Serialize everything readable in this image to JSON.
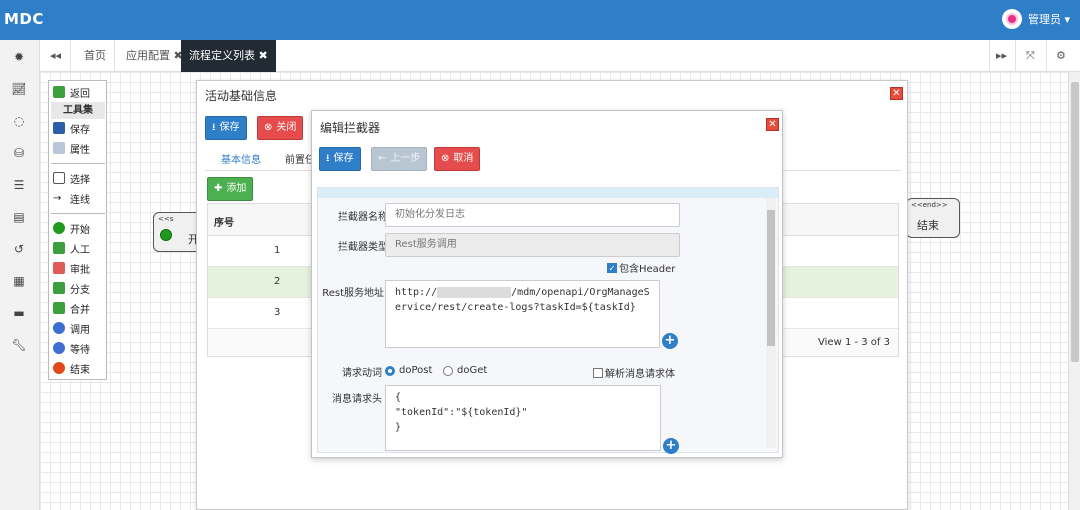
{
  "app": {
    "logo": "MDC",
    "user_name": "管理员 ▾"
  },
  "tabs": {
    "home": "首页",
    "app_config": "应用配置 ✖",
    "flow_list": "流程定义列表 ✖"
  },
  "toolbox": {
    "back": "返回",
    "title": "工具集",
    "save": "保存",
    "props": "属性",
    "select": "选择",
    "connect": "连线",
    "start": "开始",
    "manual": "人工",
    "approve": "审批",
    "branch": "分支",
    "merge": "合并",
    "invoke": "调用",
    "wait": "等待",
    "end": "结束"
  },
  "flow": {
    "start_tag": "<<s",
    "start_label": "开",
    "end_tag": "<<end>>",
    "end_label": "结束"
  },
  "activity_dialog": {
    "title": "活动基础信息",
    "save": "保存",
    "close": "关闭",
    "tab_basic": "基本信息",
    "tab_pre": "前置任",
    "add": "添加",
    "col_seq": "序号",
    "rows": [
      "1",
      "2",
      "3"
    ],
    "pager": "View 1 - 3 of 3"
  },
  "interceptor_dialog": {
    "title": "编辑拦截器",
    "save": "保存",
    "prev": "上一步",
    "cancel": "取消",
    "name_label": "拦截器名称",
    "name_placeholder": "初始化分发日志",
    "type_label": "拦截器类型",
    "type_value": "Rest服务调用",
    "include_header": "包含Header",
    "url_label": "Rest服务地址",
    "url_prefix": "http://",
    "url_rest": "/mdm/openapi/OrgManageService/rest/create-logs?taskId=${taskId}",
    "method_label": "请求动词",
    "method_post": "doPost",
    "method_get": "doGet",
    "parse_body": "解析消息请求体",
    "headers_label": "消息请求头",
    "headers_value": "{\n\"tokenId\":\"${tokenId}\"\n}"
  },
  "colors": {
    "primary": "#2f7fc8",
    "danger": "#e74c4c",
    "success": "#4caf50",
    "topbar": "#2f7fc8"
  }
}
